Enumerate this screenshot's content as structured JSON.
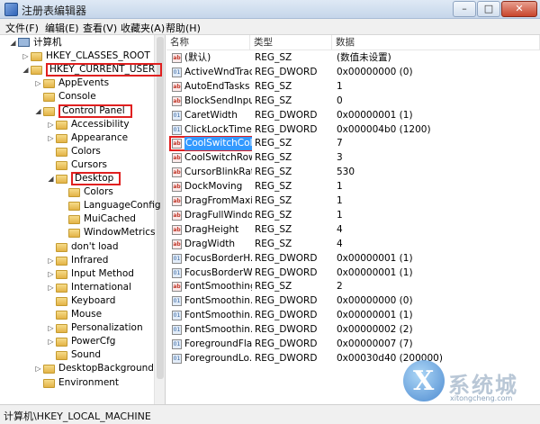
{
  "window": {
    "title": "注册表编辑器",
    "min_label": "–",
    "max_label": "□",
    "close_label": "✕"
  },
  "menu": [
    "文件(F)",
    "编辑(E)",
    "查看(V)",
    "收藏夹(A)",
    "帮助(H)"
  ],
  "tree": [
    {
      "label": "计算机",
      "indent": 0,
      "arrow": "◢",
      "icon": "computer-icon",
      "highlight": false
    },
    {
      "label": "HKEY_CLASSES_ROOT",
      "indent": 1,
      "arrow": "▷",
      "highlight": false
    },
    {
      "label": "HKEY_CURRENT_USER",
      "indent": 1,
      "arrow": "◢",
      "highlight": true
    },
    {
      "label": "AppEvents",
      "indent": 2,
      "arrow": "▷",
      "highlight": false
    },
    {
      "label": "Console",
      "indent": 2,
      "arrow": "",
      "highlight": false
    },
    {
      "label": "Control Panel",
      "indent": 2,
      "arrow": "◢",
      "highlight": true
    },
    {
      "label": "Accessibility",
      "indent": 3,
      "arrow": "▷",
      "highlight": false
    },
    {
      "label": "Appearance",
      "indent": 3,
      "arrow": "▷",
      "highlight": false
    },
    {
      "label": "Colors",
      "indent": 3,
      "arrow": "",
      "highlight": false
    },
    {
      "label": "Cursors",
      "indent": 3,
      "arrow": "",
      "highlight": false
    },
    {
      "label": "Desktop",
      "indent": 3,
      "arrow": "◢",
      "highlight": true
    },
    {
      "label": "Colors",
      "indent": 4,
      "arrow": "",
      "highlight": false
    },
    {
      "label": "LanguageConfig",
      "indent": 4,
      "arrow": "",
      "highlight": false
    },
    {
      "label": "MuiCached",
      "indent": 4,
      "arrow": "",
      "highlight": false
    },
    {
      "label": "WindowMetrics",
      "indent": 4,
      "arrow": "",
      "highlight": false
    },
    {
      "label": "don't load",
      "indent": 3,
      "arrow": "",
      "highlight": false
    },
    {
      "label": "Infrared",
      "indent": 3,
      "arrow": "▷",
      "highlight": false
    },
    {
      "label": "Input Method",
      "indent": 3,
      "arrow": "▷",
      "highlight": false
    },
    {
      "label": "International",
      "indent": 3,
      "arrow": "▷",
      "highlight": false
    },
    {
      "label": "Keyboard",
      "indent": 3,
      "arrow": "",
      "highlight": false
    },
    {
      "label": "Mouse",
      "indent": 3,
      "arrow": "",
      "highlight": false
    },
    {
      "label": "Personalization",
      "indent": 3,
      "arrow": "▷",
      "highlight": false
    },
    {
      "label": "PowerCfg",
      "indent": 3,
      "arrow": "▷",
      "highlight": false
    },
    {
      "label": "Sound",
      "indent": 3,
      "arrow": "",
      "highlight": false
    },
    {
      "label": "DesktopBackground",
      "indent": 2,
      "arrow": "▷",
      "highlight": false
    },
    {
      "label": "Environment",
      "indent": 2,
      "arrow": "",
      "highlight": false
    }
  ],
  "list_headers": {
    "name": "名称",
    "type": "类型",
    "data": "数据"
  },
  "list": [
    {
      "name": "(默认)",
      "type": "REG_SZ",
      "data": "(数值未设置)",
      "kind": "sz"
    },
    {
      "name": "ActiveWndTrac...",
      "type": "REG_DWORD",
      "data": "0x00000000 (0)",
      "kind": "dword"
    },
    {
      "name": "AutoEndTasks",
      "type": "REG_SZ",
      "data": "1",
      "kind": "sz"
    },
    {
      "name": "BlockSendInpu...",
      "type": "REG_SZ",
      "data": "0",
      "kind": "sz"
    },
    {
      "name": "CaretWidth",
      "type": "REG_DWORD",
      "data": "0x00000001 (1)",
      "kind": "dword"
    },
    {
      "name": "ClickLockTime",
      "type": "REG_DWORD",
      "data": "0x000004b0 (1200)",
      "kind": "dword"
    },
    {
      "name": "CoolSwitchCol...",
      "type": "REG_SZ",
      "data": "7",
      "kind": "sz",
      "selected": true
    },
    {
      "name": "CoolSwitchRows",
      "type": "REG_SZ",
      "data": "3",
      "kind": "sz"
    },
    {
      "name": "CursorBlinkRate",
      "type": "REG_SZ",
      "data": "530",
      "kind": "sz"
    },
    {
      "name": "DockMoving",
      "type": "REG_SZ",
      "data": "1",
      "kind": "sz"
    },
    {
      "name": "DragFromMaxi...",
      "type": "REG_SZ",
      "data": "1",
      "kind": "sz"
    },
    {
      "name": "DragFullWindo...",
      "type": "REG_SZ",
      "data": "1",
      "kind": "sz"
    },
    {
      "name": "DragHeight",
      "type": "REG_SZ",
      "data": "4",
      "kind": "sz"
    },
    {
      "name": "DragWidth",
      "type": "REG_SZ",
      "data": "4",
      "kind": "sz"
    },
    {
      "name": "FocusBorderH...",
      "type": "REG_DWORD",
      "data": "0x00000001 (1)",
      "kind": "dword"
    },
    {
      "name": "FocusBorderW...",
      "type": "REG_DWORD",
      "data": "0x00000001 (1)",
      "kind": "dword"
    },
    {
      "name": "FontSmoothing",
      "type": "REG_SZ",
      "data": "2",
      "kind": "sz"
    },
    {
      "name": "FontSmoothin...",
      "type": "REG_DWORD",
      "data": "0x00000000 (0)",
      "kind": "dword"
    },
    {
      "name": "FontSmoothin...",
      "type": "REG_DWORD",
      "data": "0x00000001 (1)",
      "kind": "dword"
    },
    {
      "name": "FontSmoothin...",
      "type": "REG_DWORD",
      "data": "0x00000002 (2)",
      "kind": "dword"
    },
    {
      "name": "ForegroundFla...",
      "type": "REG_DWORD",
      "data": "0x00000007 (7)",
      "kind": "dword"
    },
    {
      "name": "ForegroundLo...",
      "type": "REG_DWORD",
      "data": "0x00030d40 (200000)",
      "kind": "dword"
    }
  ],
  "status": "计算机\\HKEY_LOCAL_MACHINE",
  "watermark": {
    "text": "系统城",
    "url": "xitongcheng.com"
  }
}
